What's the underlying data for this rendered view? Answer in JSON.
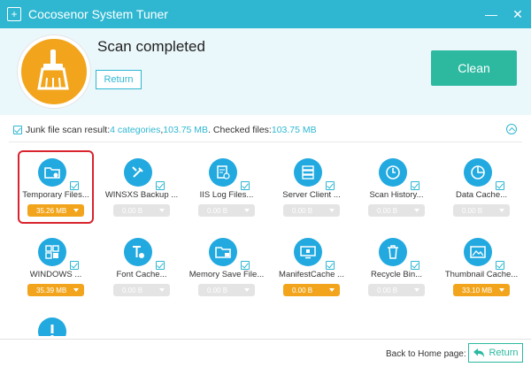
{
  "window": {
    "title": "Cocosenor System Tuner",
    "minimize_glyph": "—",
    "close_glyph": "✕"
  },
  "header": {
    "status_title": "Scan completed",
    "return_label": "Return",
    "clean_label": "Clean"
  },
  "summary": {
    "prefix": "Junk file scan result: ",
    "categories": "4 categories",
    "sep1": ", ",
    "size": "103.75 MB",
    "checked_label": " . Checked files: ",
    "checked_size": "103.75 MB"
  },
  "items": [
    {
      "label": "Temporary Files...",
      "size": "35.26 MB",
      "active": true,
      "icon": "folder-icon"
    },
    {
      "label": "WINSXS Backup ...",
      "size": "0.00 B",
      "active": false,
      "icon": "tools-icon"
    },
    {
      "label": "IIS Log Files...",
      "size": "0.00 B",
      "active": false,
      "icon": "log-file-icon"
    },
    {
      "label": "Server Client ...",
      "size": "0.00 B",
      "active": false,
      "icon": "server-icon"
    },
    {
      "label": "Scan History...",
      "size": "0.00 B",
      "active": false,
      "icon": "clock-icon"
    },
    {
      "label": "Data Cache...",
      "size": "0.00 B",
      "active": false,
      "icon": "pie-chart-icon"
    },
    {
      "label": "WINDOWS ...",
      "size": "35.39 MB",
      "active": true,
      "icon": "windows-icon"
    },
    {
      "label": "Font Cache...",
      "size": "0.00 B",
      "active": false,
      "icon": "font-icon"
    },
    {
      "label": "Memory Save File...",
      "size": "0.00 B",
      "active": false,
      "icon": "memory-folder-icon"
    },
    {
      "label": "ManifestCache ...",
      "size": "0.00 B",
      "active": true,
      "icon": "monitor-icon"
    },
    {
      "label": "Recycle Bin...",
      "size": "0.00 B",
      "active": false,
      "icon": "recycle-bin-icon"
    },
    {
      "label": "Thumbnail Cache...",
      "size": "33.10 MB",
      "active": true,
      "icon": "thumbnail-icon"
    },
    {
      "label": "",
      "size": "",
      "active": false,
      "icon": "warning-icon"
    }
  ],
  "footer": {
    "home_label": "Back to Home page:",
    "return_label": "Return"
  },
  "colors": {
    "titlebar": "#2fb7d2",
    "accent": "#2fb7d2",
    "clean": "#2cb9a0",
    "orange": "#f2a51c",
    "icon_blue": "#22a9e0",
    "highlight": "#d9232e"
  }
}
